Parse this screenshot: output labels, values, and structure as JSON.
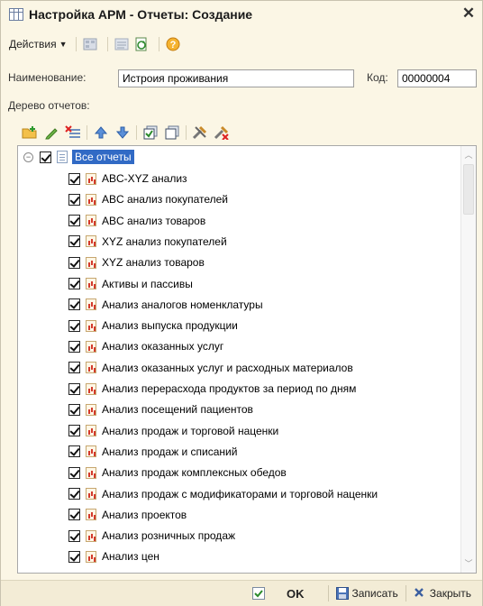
{
  "window": {
    "title": "Настройка АРМ - Отчеты: Создание",
    "close_glyph": "✕"
  },
  "toolbar": {
    "actions_label": "Действия",
    "buttons": [
      "grid-icon",
      "list-icon",
      "refresh-doc-icon",
      "help-icon"
    ]
  },
  "form": {
    "name_label": "Наименование:",
    "name_value": "Истроия проживания",
    "code_label": "Код:",
    "code_value": "00000004",
    "tree_label": "Дерево отчетов:"
  },
  "tree_toolbar": {
    "buttons": [
      "add-folder-icon",
      "edit-icon",
      "delete-icon",
      "move-up-icon",
      "move-down-icon",
      "check-all-icon",
      "uncheck-all-icon",
      "tools-icon",
      "tools-clear-icon"
    ]
  },
  "tree": {
    "root_label": "Все отчеты",
    "items": [
      "ABC-XYZ анализ",
      "ABC анализ покупателей",
      "ABC анализ товаров",
      "XYZ анализ покупателей",
      "XYZ анализ товаров",
      "Активы и пассивы",
      "Анализ аналогов номенклатуры",
      "Анализ выпуска продукции",
      "Анализ оказанных услуг",
      "Анализ оказанных услуг и расходных материалов",
      "Анализ перерасхода продуктов за период по дням",
      "Анализ посещений пациентов",
      "Анализ продаж и торговой наценки",
      "Анализ продаж и списаний",
      "Анализ продаж комплексных обедов",
      "Анализ продаж с модификаторами и торговой наценки",
      "Анализ проектов",
      "Анализ розничных продаж",
      "Анализ цен"
    ]
  },
  "footer": {
    "ok_label": "OK",
    "save_label": "Записать",
    "close_label": "Закрыть"
  },
  "colors": {
    "window_bg": "#fbf6e5",
    "selection": "#316ac5",
    "accent_orange": "#f0a020"
  }
}
